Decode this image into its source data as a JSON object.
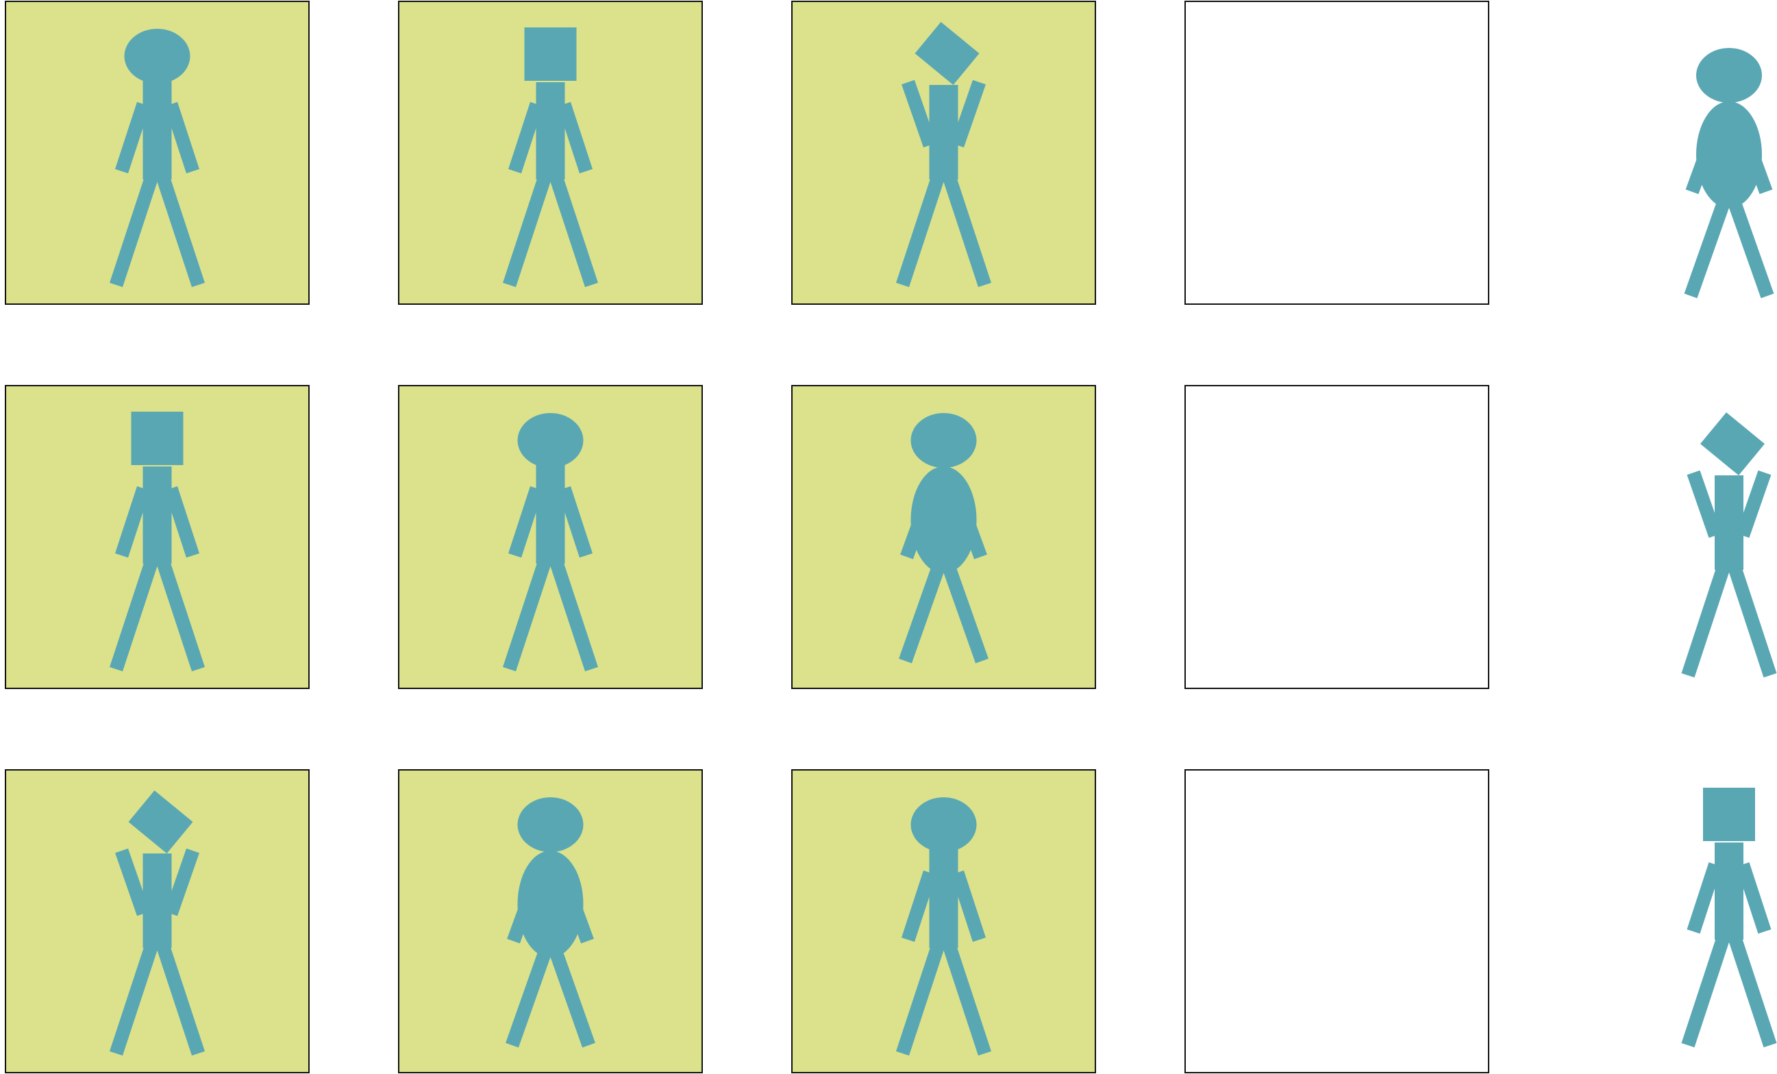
{
  "colors": {
    "figure": "#5aa7b4",
    "panel_fill": "#dbe28b",
    "panel_empty": "#ffffff",
    "panel_stroke": "#111111"
  },
  "grid": [
    [
      {
        "panel": "filled",
        "figure": {
          "head": "round",
          "body": "thin",
          "arms": "down"
        }
      },
      {
        "panel": "filled",
        "figure": {
          "head": "square",
          "body": "thin",
          "arms": "down"
        }
      },
      {
        "panel": "filled",
        "figure": {
          "head": "diamond",
          "body": "thin",
          "arms": "up"
        }
      },
      {
        "panel": "empty",
        "figure": null
      }
    ],
    [
      {
        "panel": "filled",
        "figure": {
          "head": "square",
          "body": "thin",
          "arms": "down"
        }
      },
      {
        "panel": "filled",
        "figure": {
          "head": "round",
          "body": "thin",
          "arms": "down"
        }
      },
      {
        "panel": "filled",
        "figure": {
          "head": "round",
          "body": "oval",
          "arms": "down"
        }
      },
      {
        "panel": "empty",
        "figure": null
      }
    ],
    [
      {
        "panel": "filled",
        "figure": {
          "head": "diamond",
          "body": "thin",
          "arms": "up"
        }
      },
      {
        "panel": "filled",
        "figure": {
          "head": "round",
          "body": "oval",
          "arms": "down"
        }
      },
      {
        "panel": "filled",
        "figure": {
          "head": "round",
          "body": "thin",
          "arms": "down"
        }
      },
      {
        "panel": "empty",
        "figure": null
      }
    ]
  ],
  "options": [
    {
      "figure": {
        "head": "round",
        "body": "oval",
        "arms": "down"
      }
    },
    {
      "figure": {
        "head": "diamond",
        "body": "thin",
        "arms": "up"
      }
    },
    {
      "figure": {
        "head": "square",
        "body": "thin",
        "arms": "down"
      }
    }
  ]
}
